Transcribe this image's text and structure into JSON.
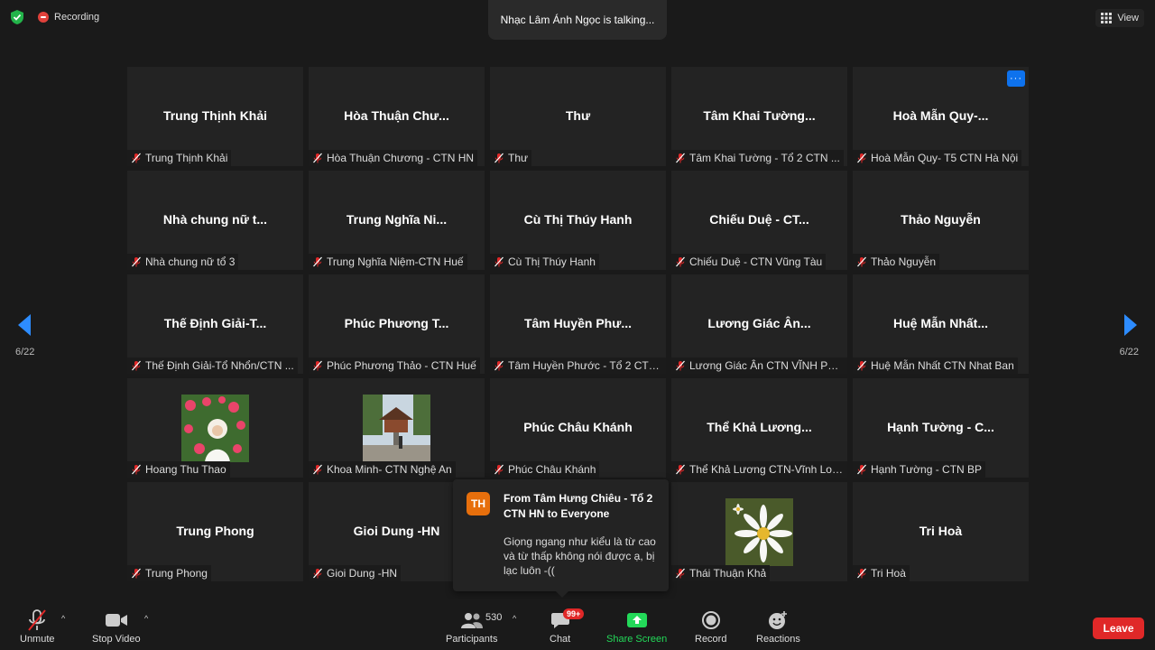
{
  "top": {
    "recording_label": "Recording",
    "talking_text": "Nhạc Lâm Ánh Ngọc is talking...",
    "view_label": "View"
  },
  "navigation": {
    "page_left": "6/22",
    "page_right": "6/22"
  },
  "tiles": [
    {
      "name": "Trung Thịnh Khải",
      "label": "Trung Thịnh Khải"
    },
    {
      "name": "Hòa Thuận Chư...",
      "label": "Hòa Thuận Chương - CTN HN"
    },
    {
      "name": "Thư",
      "label": "Thư"
    },
    {
      "name": "Tâm Khai Tường...",
      "label": "Tâm Khai Tường - Tổ 2 CTN ..."
    },
    {
      "name": "Hoà Mẫn Quy-...",
      "label": "Hoà Mẫn Quy- T5 CTN Hà Nội"
    },
    {
      "name": "Nhà chung nữ t...",
      "label": "Nhà chung nữ tổ 3"
    },
    {
      "name": "Trung Nghĩa Ni...",
      "label": "Trung Nghĩa Niệm-CTN Huế"
    },
    {
      "name": "Cù Thị Thúy Hanh",
      "label": "Cù Thị Thúy Hanh"
    },
    {
      "name": "Chiếu Duệ - CT...",
      "label": "Chiếu Duệ - CTN Vũng Tàu"
    },
    {
      "name": "Thảo Nguyễn",
      "label": "Thảo Nguyễn"
    },
    {
      "name": "Thế Định Giải-T...",
      "label": "Thế Định Giải-Tổ Nhổn/CTN ..."
    },
    {
      "name": "Phúc Phương T...",
      "label": "Phúc Phương Thảo - CTN Huế"
    },
    {
      "name": "Tâm Huyền Phư...",
      "label": "Tâm Huyền Phước - Tổ 2 CTN..."
    },
    {
      "name": "Lương Giác Ân...",
      "label": "Lương Giác Ân CTN VĨNH PH..."
    },
    {
      "name": "Huệ Mẫn Nhất...",
      "label": "Huệ Mẫn Nhất CTN Nhat Ban"
    },
    {
      "name": "",
      "label": "Hoang Thu Thao",
      "photo": "roses"
    },
    {
      "name": "",
      "label": "Khoa Minh- CTN Nghệ An",
      "photo": "temple"
    },
    {
      "name": "Phúc Châu Khánh",
      "label": "Phúc Châu Khánh"
    },
    {
      "name": "Thể Khả Lương...",
      "label": "Thể Khả Lương CTN-Vĩnh Long"
    },
    {
      "name": "Hạnh Tường - C...",
      "label": "Hạnh Tường - CTN BP"
    },
    {
      "name": "Trung Phong",
      "label": "Trung Phong"
    },
    {
      "name": "Gioi Dung -HN",
      "label": "Gioi Dung -HN"
    },
    {
      "name": "",
      "label": ""
    },
    {
      "name": "",
      "label": "Thái Thuận Khả",
      "photo": "daisy"
    },
    {
      "name": "Tri Hoà",
      "label": "Tri Hoà"
    }
  ],
  "chat_popup": {
    "avatar_initials": "TH",
    "from": "From Tâm Hưng Chiêu - Tổ 2 CTN HN to Everyone",
    "message": "Giọng ngang như kiểu là từ cao và từ thấp không nói được ạ, bị lạc luôn -(("
  },
  "toolbar": {
    "unmute": "Unmute",
    "stop_video": "Stop Video",
    "participants": "Participants",
    "participants_count": "530",
    "chat": "Chat",
    "chat_badge": "99+",
    "share_screen": "Share Screen",
    "record": "Record",
    "reactions": "Reactions",
    "leave": "Leave"
  },
  "colors": {
    "background": "#1a1a1a",
    "tile": "#232323",
    "accent_blue": "#0e72ed",
    "leave_red": "#e02828",
    "share_green": "#23d959",
    "avatar_orange": "#e76f0c"
  }
}
